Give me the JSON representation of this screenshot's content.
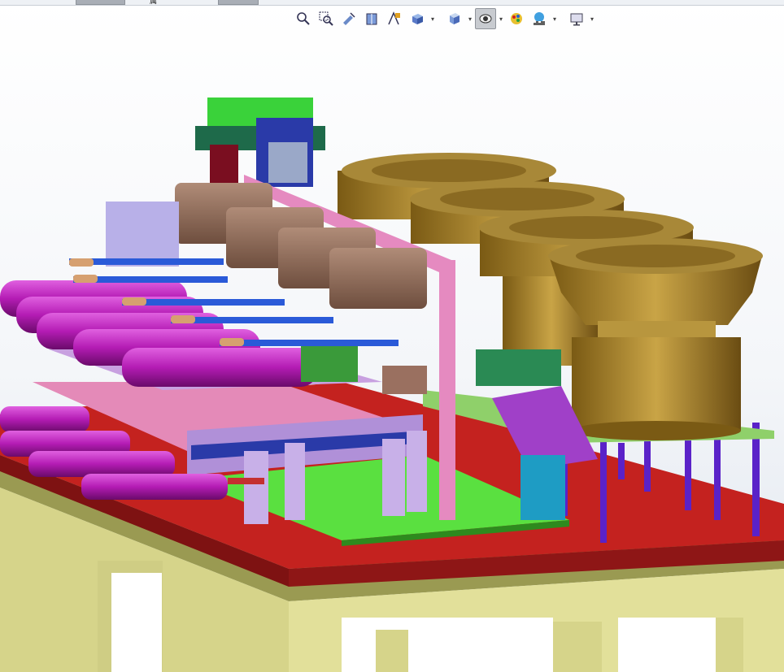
{
  "window": {
    "top_tabs": [
      "",
      ""
    ],
    "top_glyph": "属"
  },
  "heads_up_toolbar": {
    "buttons": [
      {
        "name": "zoom-to-fit",
        "icon": "zoom-to-fit-icon"
      },
      {
        "name": "zoom-to-area",
        "icon": "zoom-to-area-icon"
      },
      {
        "name": "previous-view",
        "icon": "previous-view-icon"
      },
      {
        "name": "section-view",
        "icon": "section-view-icon"
      },
      {
        "name": "dynamic-annotation-views",
        "icon": "dynamic-annotation-icon"
      },
      {
        "name": "view-orientation",
        "icon": "view-orientation-icon",
        "dropdown": true
      },
      {
        "name": "display-style",
        "icon": "display-style-icon",
        "dropdown": true
      },
      {
        "name": "hide-show-items",
        "icon": "hide-show-icon",
        "dropdown": true,
        "active": true
      },
      {
        "name": "edit-appearance",
        "icon": "edit-appearance-icon"
      },
      {
        "name": "apply-scene",
        "icon": "apply-scene-icon",
        "dropdown": true
      },
      {
        "name": "view-settings",
        "icon": "monitor-icon",
        "dropdown": true
      }
    ]
  },
  "model": {
    "description_colors": {
      "table_top": "#c4221f",
      "table_frame": "#d8d68a",
      "feeder_bowl": "#9a7a2a",
      "cylinder": "#b020b0",
      "motor": "#8c6a58",
      "plate_pink": "#e58ac0",
      "plate_green": "#5ae040",
      "post_purple": "#5a22c8"
    }
  }
}
